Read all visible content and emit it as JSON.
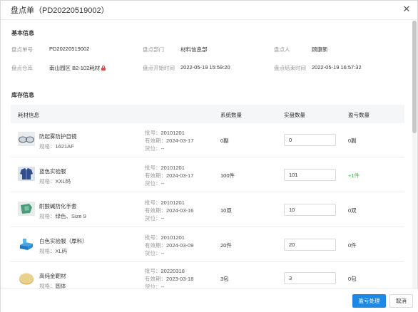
{
  "dialog": {
    "title": "盘点单（PD20220519002）",
    "close_glyph": "✕"
  },
  "basic": {
    "section_title": "基本信息",
    "fields": [
      {
        "label": "盘点单号",
        "value": "PD20220519002"
      },
      {
        "label": "盘点部门",
        "value": "材料信息部"
      },
      {
        "label": "盘点人",
        "value": "顾康新"
      },
      {
        "label": "盘点仓库",
        "value": "南山园区 B2-102耗材"
      },
      {
        "label": "盘点开始时间",
        "value": "2022-05-19 15:59:20"
      },
      {
        "label": "盘点结束时间",
        "value": "2022-05-19 16:57:32"
      }
    ]
  },
  "inventory": {
    "section_title": "库存信息",
    "columns": [
      "耗材信息",
      "系统数量",
      "实盘数量",
      "盈亏数量"
    ],
    "meta_labels": {
      "batch": "批号：",
      "expiry": "有效期：",
      "location": "货位："
    },
    "spec_label": "规格：",
    "rows": [
      {
        "name": "防起雾防护目镜",
        "spec": "1621AF",
        "batch": "20101201",
        "expiry": "2024-03-17",
        "location": "--",
        "system_qty": "0副",
        "actual_qty": "0",
        "diff": "0副",
        "diff_positive": false,
        "thumb": "goggles-thumb"
      },
      {
        "name": "蓝色实验服",
        "spec": "XXL码",
        "batch": "20101201",
        "expiry": "2024-03-17",
        "location": "--",
        "system_qty": "100件",
        "actual_qty": "101",
        "diff": "+1件",
        "diff_positive": true,
        "thumb": "labcoat-blue-thumb"
      },
      {
        "name": "耐酸碱防化手套",
        "spec": "绿色、Size 9",
        "batch": "20101201",
        "expiry": "2024-03-16",
        "location": "--",
        "system_qty": "10双",
        "actual_qty": "10",
        "diff": "0双",
        "diff_positive": false,
        "thumb": "gloves-thumb"
      },
      {
        "name": "白色实验服（厚料）",
        "spec": "XL码",
        "batch": "20101201",
        "expiry": "2024-03-09",
        "location": "--",
        "system_qty": "20件",
        "actual_qty": "20",
        "diff": "0件",
        "diff_positive": false,
        "thumb": "labcoat-white-thumb"
      },
      {
        "name": "高纯金靶材",
        "spec": "圆体",
        "batch": "20220318",
        "expiry": "2023-03-18",
        "location": "--",
        "system_qty": "3包",
        "actual_qty": "3",
        "diff": "0包",
        "diff_positive": false,
        "thumb": "gold-target-thumb"
      }
    ]
  },
  "footer": {
    "primary_label": "盈亏处理",
    "cancel_label": "取消"
  },
  "colors": {
    "primary": "#1e88e5",
    "positive": "#3cb64a",
    "lock": "#e0484a"
  }
}
